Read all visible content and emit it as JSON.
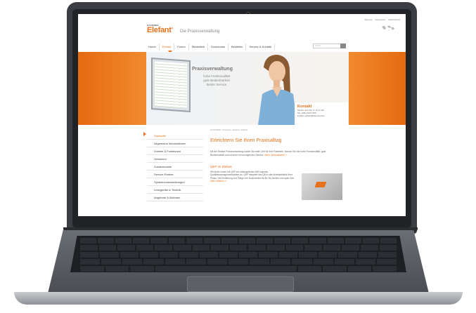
{
  "topbar": {
    "links": [
      "Sitemap",
      "Impressum",
      "Datenschutz"
    ]
  },
  "logo": {
    "brand": "HASOMED",
    "name": "Elefant",
    "mark": "®",
    "tagline": "Die Praxisverwaltung"
  },
  "nav": {
    "items": [
      "Home",
      "Elefant",
      "Forum",
      "Mediathek",
      "Downloads",
      "Bestellen",
      "Service & Kontakt"
    ],
    "active": "Elefant"
  },
  "search": {
    "placeholder": "Suche"
  },
  "hero": {
    "title": "Praxisverwaltung",
    "lines": [
      "hohe Funktionalität",
      "gute Bedienbarkeit",
      "bester Service"
    ]
  },
  "kontakt": {
    "title": "Kontakt",
    "lines": [
      "Mo-Do und Uhr, Fr: 8-17 Uhr",
      "Tel.: 0391 6107-650",
      "E-Mail: elefant@hasomed.de"
    ]
  },
  "sidebar": {
    "items": [
      "Startseite",
      "Allgemeine Informationen",
      "Vorteile & Funktionen",
      "Versionen",
      "Zusatzmodule",
      "Service-Partner",
      "Systemvoraussetzungen",
      "Lesegeräte & Technik",
      "Angebote & Aktionen"
    ],
    "active": "Startseite"
  },
  "content": {
    "breadcrumb": "HASOMED / Produkte / Elefant / Elefant",
    "headline": "Erleichtern Sie Ihren Praxisalltag",
    "paragraph": "Mit der Elefant Praxisverwaltung haben Sie mehr Zeit für Ihre Patienten. Nutzen Sie die hohe Funktionalität, gute Bedienbarkeit und unseren hervorragenden Service.",
    "paragraph_link": "Mehr Informationen »",
    "sub_title": "QEP im Elefant",
    "sub_paragraph": "Wir bieten Ihnen mit QEP ein umfangreiches KBV-eigenes Qualitätsmanagementsystem an. QEP integriert das QM in alle Arbeitsabläufe Ihrer Praxis. Die Einführung und Pflege von Dokumenten ist für Sie leichter und spart Zeit.",
    "sub_link": "Mehr erfahren »"
  },
  "colors": {
    "accent": "#e8721c",
    "bezel": "#202226"
  }
}
